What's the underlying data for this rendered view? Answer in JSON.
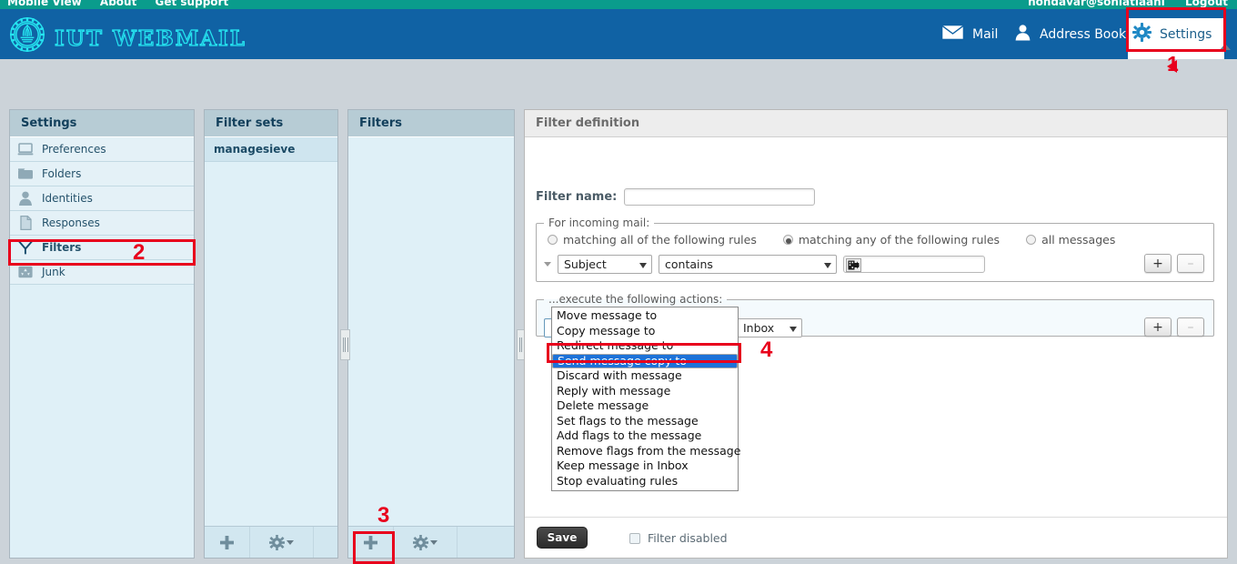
{
  "topbar": {
    "left_links": [
      "Mobile View",
      "About",
      "Get support"
    ],
    "user_email": "nohdavar@soniatiaahi",
    "logout_label": "Logout"
  },
  "brand": {
    "title": "IUT WEBMAIL",
    "logo_icon": "gear-emblem-icon",
    "nav": [
      {
        "label": "Mail",
        "icon": "envelope-icon",
        "selected": false
      },
      {
        "label": "Address Book",
        "icon": "person-icon",
        "selected": false
      },
      {
        "label": "Settings",
        "icon": "gear-icon",
        "selected": true
      }
    ]
  },
  "annotations": [
    {
      "number": "1",
      "target": "settings-nav-tab"
    },
    {
      "number": "2",
      "target": "sidebar-item-filters"
    },
    {
      "number": "3",
      "target": "add-filter-button"
    },
    {
      "number": "4",
      "target": "option-send-message-copy-to"
    }
  ],
  "settings_panel": {
    "title": "Settings",
    "items": [
      {
        "label": "Preferences",
        "icon": "laptop-icon",
        "selected": false
      },
      {
        "label": "Folders",
        "icon": "folder-icon",
        "selected": false
      },
      {
        "label": "Identities",
        "icon": "person-icon",
        "selected": false
      },
      {
        "label": "Responses",
        "icon": "document-icon",
        "selected": false
      },
      {
        "label": "Filters",
        "icon": "funnel-icon",
        "selected": true
      },
      {
        "label": "Junk",
        "icon": "recycle-icon",
        "selected": false
      }
    ],
    "footer": []
  },
  "filtersets_panel": {
    "title": "Filter sets",
    "rows": [
      {
        "label": "managesieve",
        "selected": true
      }
    ],
    "footer": {
      "add_icon": "plus-icon",
      "actions_icon": "gear-icon",
      "actions_caret": "chevron-down-icon"
    }
  },
  "filters_panel": {
    "title": "Filters",
    "rows": [],
    "footer": {
      "add_icon": "plus-icon",
      "actions_icon": "gear-icon",
      "actions_caret": "chevron-down-icon"
    }
  },
  "splitters": [
    "column-splitter-1",
    "column-splitter-2"
  ],
  "filter_definition": {
    "title": "Filter definition",
    "filter_name_label": "Filter name:",
    "filter_name_value": "",
    "filter_name_placeholder": "",
    "incoming": {
      "legend": "For incoming mail:",
      "options": [
        {
          "label": "matching all of the following rules",
          "checked": false
        },
        {
          "label": "matching any of the following rules",
          "checked": true
        },
        {
          "label": "all messages",
          "checked": false
        }
      ],
      "rule": {
        "row_caret": "chevron-down-icon",
        "header_value": "Subject",
        "operator_value": "contains",
        "value": "",
        "value_icon": "insert-variable-icon",
        "add_label": "+",
        "remove_label": "–"
      }
    },
    "actions": {
      "legend": "...execute the following actions:",
      "action_value": "Move message to",
      "folder_value": "Inbox",
      "add_label": "+",
      "remove_label": "–",
      "dropdown_open": true,
      "dropdown_options": [
        {
          "label": "Move message to",
          "highlighted": false
        },
        {
          "label": "Copy message to",
          "highlighted": false
        },
        {
          "label": "Redirect message to",
          "highlighted": false
        },
        {
          "label": "Send message copy to",
          "highlighted": true
        },
        {
          "label": "Discard with message",
          "highlighted": false
        },
        {
          "label": "Reply with message",
          "highlighted": false
        },
        {
          "label": "Delete message",
          "highlighted": false
        },
        {
          "label": "Set flags to the message",
          "highlighted": false
        },
        {
          "label": "Add flags to the message",
          "highlighted": false
        },
        {
          "label": "Remove flags from the message",
          "highlighted": false
        },
        {
          "label": "Keep message in Inbox",
          "highlighted": false
        },
        {
          "label": "Stop evaluating rules",
          "highlighted": false
        }
      ]
    },
    "footer": {
      "save_label": "Save",
      "filter_disabled_label": "Filter disabled",
      "filter_disabled_checked": false
    }
  },
  "colors": {
    "topbar_teal": "#0a9c8c",
    "brand_blue": "#1062a4",
    "logo_cyan": "#25e4f0",
    "panel_head": "#b7ccd5",
    "panel_body": "#dff0f7",
    "annotation_red": "#e8001c",
    "dropdown_highlight": "#1d72d8",
    "page_bg": "#ccd3d9"
  }
}
